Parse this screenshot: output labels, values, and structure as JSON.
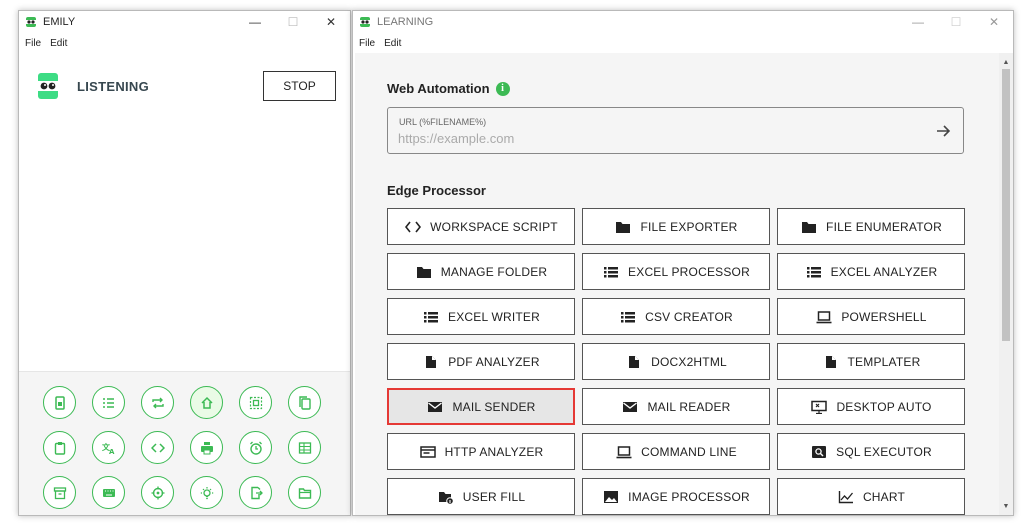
{
  "emily_window": {
    "title": "EMILY",
    "menu": [
      "File",
      "Edit"
    ],
    "status": "LISTENING",
    "stop_label": "STOP",
    "tools": [
      {
        "icon": "document-icon"
      },
      {
        "icon": "list-add-icon"
      },
      {
        "icon": "repeat-icon"
      },
      {
        "icon": "home-icon"
      },
      {
        "icon": "select-area-icon"
      },
      {
        "icon": "copy-icon"
      },
      {
        "icon": "clipboard-icon"
      },
      {
        "icon": "translate-icon"
      },
      {
        "icon": "code-icon"
      },
      {
        "icon": "print-icon"
      },
      {
        "icon": "alarm-icon"
      },
      {
        "icon": "table-icon"
      },
      {
        "icon": "archive-icon"
      },
      {
        "icon": "keyboard-icon"
      },
      {
        "icon": "crosshair-icon"
      },
      {
        "icon": "lightbulb-icon"
      },
      {
        "icon": "file-export-icon"
      },
      {
        "icon": "folder-open-icon"
      }
    ]
  },
  "learning_window": {
    "title": "LEARNING",
    "menu": [
      "File",
      "Edit"
    ],
    "web_automation": {
      "title": "Web Automation",
      "info": "i",
      "url_label": "URL (%FILENAME%)",
      "url_placeholder": "https://example.com"
    },
    "edge_processor": {
      "title": "Edge Processor",
      "items": [
        {
          "label": "WORKSPACE SCRIPT",
          "icon": "code-icon"
        },
        {
          "label": "FILE EXPORTER",
          "icon": "folder-icon"
        },
        {
          "label": "FILE ENUMERATOR",
          "icon": "folder-icon"
        },
        {
          "label": "MANAGE FOLDER",
          "icon": "folder-icon"
        },
        {
          "label": "EXCEL PROCESSOR",
          "icon": "list-icon"
        },
        {
          "label": "EXCEL ANALYZER",
          "icon": "list-icon"
        },
        {
          "label": "EXCEL WRITER",
          "icon": "list-icon"
        },
        {
          "label": "CSV CREATOR",
          "icon": "list-icon"
        },
        {
          "label": "POWERSHELL",
          "icon": "laptop-icon"
        },
        {
          "label": "PDF ANALYZER",
          "icon": "file-icon"
        },
        {
          "label": "DOCX2HTML",
          "icon": "file-icon"
        },
        {
          "label": "TEMPLATER",
          "icon": "file-icon"
        },
        {
          "label": "MAIL SENDER",
          "icon": "mail-icon"
        },
        {
          "label": "MAIL READER",
          "icon": "mail-icon"
        },
        {
          "label": "DESKTOP AUTO",
          "icon": "desktop-icon"
        },
        {
          "label": "HTTP ANALYZER",
          "icon": "browser-icon"
        },
        {
          "label": "COMMAND LINE",
          "icon": "laptop-icon"
        },
        {
          "label": "SQL EXECUTOR",
          "icon": "search-box-icon"
        },
        {
          "label": "USER FILL",
          "icon": "folder-info-icon"
        },
        {
          "label": "IMAGE PROCESSOR",
          "icon": "image-icon"
        },
        {
          "label": "CHART",
          "icon": "chart-icon"
        }
      ]
    }
  },
  "colors": {
    "accent": "#3cba54",
    "selected_border": "#e53935"
  }
}
